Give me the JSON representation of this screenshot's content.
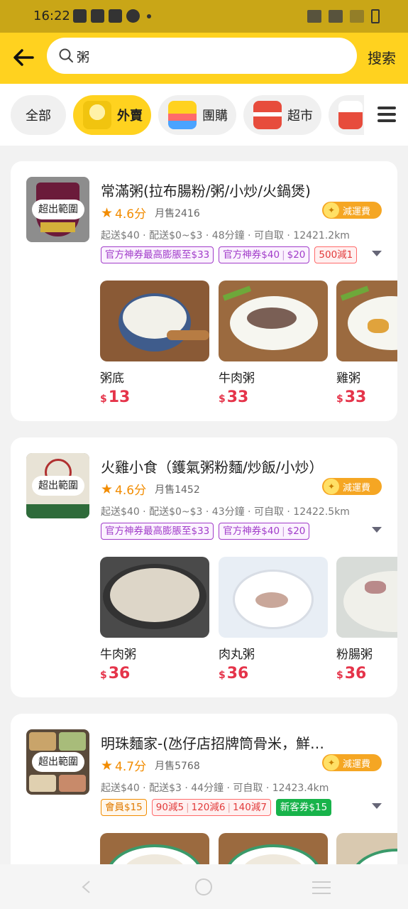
{
  "status_bar": {
    "time": "16:22"
  },
  "search": {
    "query": "粥",
    "button": "搜索"
  },
  "categories": [
    {
      "label": "全部"
    },
    {
      "label": "外賣"
    },
    {
      "label": "團購"
    },
    {
      "label": "超市"
    }
  ],
  "stores": [
    {
      "name": "常滿粥(拉布腸粉/粥/小炒/火鍋煲)",
      "out_of_range": "超出範圍",
      "rating": "4.6分",
      "monthly_sales": "月售2416",
      "badge": "減運費",
      "meta": "起送$40 · 配送$0~$3 · 48分鐘 · 可自取 · 12421.2km",
      "tags": [
        {
          "text": "官方神券最高膨脹至$33",
          "style": "purple"
        },
        {
          "parts": [
            "官方神券$40",
            "$20"
          ],
          "style": "purple"
        },
        {
          "text": "500減1",
          "style": "red"
        }
      ],
      "dishes": [
        {
          "name": "粥底",
          "currency": "$",
          "price": "13"
        },
        {
          "name": "牛肉粥",
          "currency": "$",
          "price": "33"
        },
        {
          "name": "雞粥",
          "currency": "$",
          "price": "33"
        }
      ]
    },
    {
      "name": "火雞小食（鑊氣粥粉麵/炒飯/小炒）",
      "out_of_range": "超出範圍",
      "rating": "4.6分",
      "monthly_sales": "月售1452",
      "badge": "減運費",
      "meta": "起送$40 · 配送$0~$3 · 43分鐘 · 可自取 · 12422.5km",
      "tags": [
        {
          "text": "官方神券最高膨脹至$33",
          "style": "purple"
        },
        {
          "parts": [
            "官方神券$40",
            "$20"
          ],
          "style": "purple"
        }
      ],
      "dishes": [
        {
          "name": "牛肉粥",
          "currency": "$",
          "price": "36"
        },
        {
          "name": "肉丸粥",
          "currency": "$",
          "price": "36"
        },
        {
          "name": "粉腸粥",
          "currency": "$",
          "price": "36"
        }
      ]
    },
    {
      "name": "明珠麵家-(氹仔店招牌筒骨米，鮮…",
      "out_of_range": "超出範圍",
      "rating": "4.7分",
      "monthly_sales": "月售5768",
      "badge": "減運費",
      "meta": "起送$40 · 配送$3 · 44分鐘 · 可自取 · 12423.4km",
      "tags": [
        {
          "text": "會員$15",
          "style": "orange"
        },
        {
          "parts": [
            "90減5",
            "120減6",
            "140減7"
          ],
          "style": "red"
        },
        {
          "text": "新客券$15",
          "style": "green"
        }
      ],
      "dishes": [
        {
          "name": "",
          "currency": "",
          "price": ""
        },
        {
          "name": "",
          "currency": "",
          "price": ""
        },
        {
          "name": "",
          "currency": "",
          "price": ""
        }
      ]
    }
  ]
}
